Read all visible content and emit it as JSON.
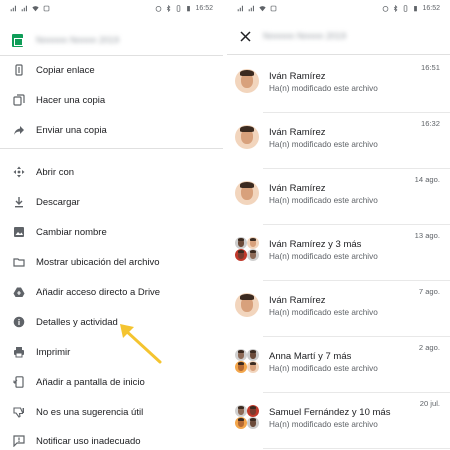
{
  "status_bar": {
    "time_left": "16:52",
    "time_right": "16:52"
  },
  "left_panel": {
    "file_icon": "sheets-icon",
    "file_title_blurred": "Nnnnnn Nnnnn 2019",
    "menu": [
      {
        "id": "copy-link",
        "icon": "link-icon",
        "label": "Copiar enlace"
      },
      {
        "id": "make-copy",
        "icon": "copy-icon",
        "label": "Hacer una copia"
      },
      {
        "id": "send-copy",
        "icon": "share-arrow-icon",
        "label": "Enviar una copia"
      },
      {
        "id": "open-with",
        "icon": "move-icon",
        "label": "Abrir con"
      },
      {
        "id": "download",
        "icon": "download-icon",
        "label": "Descargar"
      },
      {
        "id": "rename",
        "icon": "image-edit-icon",
        "label": "Cambiar nombre"
      },
      {
        "id": "show-location",
        "icon": "folder-icon",
        "label": "Mostrar ubicación del archivo"
      },
      {
        "id": "add-shortcut",
        "icon": "drive-shortcut-icon",
        "label": "Añadir acceso directo a Drive"
      },
      {
        "id": "details-activity",
        "icon": "info-icon",
        "label": "Detalles y actividad"
      },
      {
        "id": "print",
        "icon": "print-icon",
        "label": "Imprimir"
      },
      {
        "id": "add-home",
        "icon": "add-to-home-icon",
        "label": "Añadir a pantalla de inicio"
      },
      {
        "id": "not-useful",
        "icon": "thumbs-down-icon",
        "label": "No es una sugerencia útil"
      },
      {
        "id": "report-abuse",
        "icon": "report-icon",
        "label": "Notificar uso inadecuado"
      }
    ],
    "annotation_color": "#f4c430"
  },
  "right_panel": {
    "title_blurred": "Nnnnnn Nnnnn 2019",
    "activities": [
      {
        "name": "Iván Ramírez",
        "desc": "Ha(n) modificado este archivo",
        "time": "16:51",
        "avatars": "single"
      },
      {
        "name": "Iván Ramírez",
        "desc": "Ha(n) modificado este archivo",
        "time": "16:32",
        "avatars": "single"
      },
      {
        "name": "Iván Ramírez",
        "desc": "Ha(n) modificado este archivo",
        "time": "14 ago.",
        "avatars": "single"
      },
      {
        "name": "Iván Ramírez y 3 más",
        "desc": "Ha(n) modificado este archivo",
        "time": "13 ago.",
        "avatars": "group"
      },
      {
        "name": "Iván Ramírez",
        "desc": "Ha(n) modificado este archivo",
        "time": "7 ago.",
        "avatars": "single"
      },
      {
        "name": "Anna Martí y 7 más",
        "desc": "Ha(n) modificado este archivo",
        "time": "2 ago.",
        "avatars": "group"
      },
      {
        "name": "Samuel Fernández y 10 más",
        "desc": "Ha(n) modificado este archivo",
        "time": "20 jul.",
        "avatars": "group"
      }
    ]
  }
}
